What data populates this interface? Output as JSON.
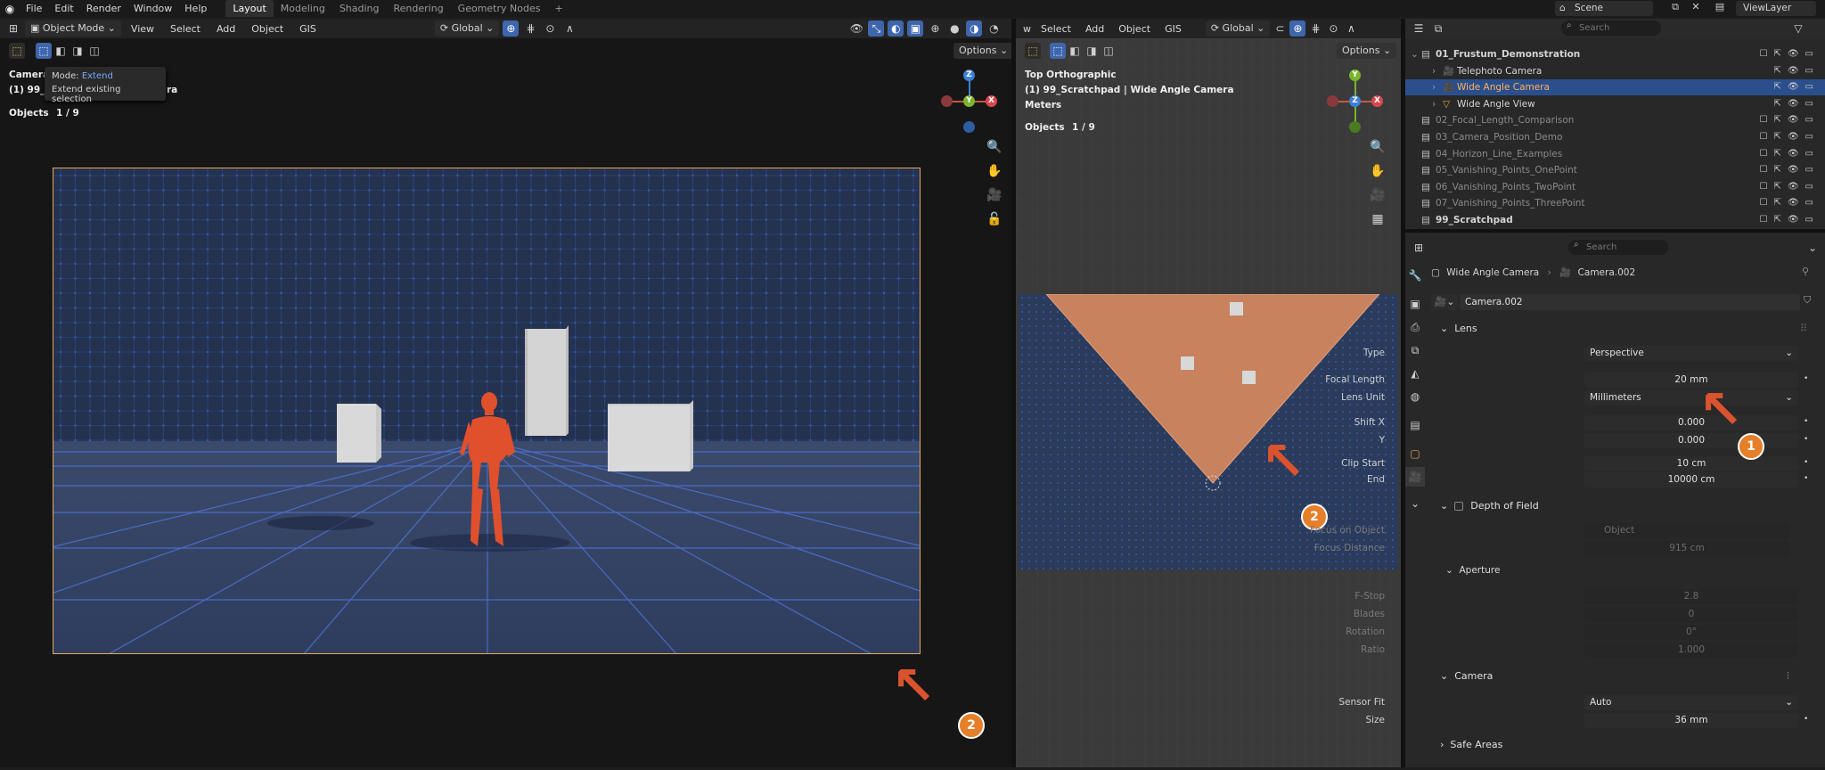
{
  "topbar": {
    "menus": [
      "File",
      "Edit",
      "Render",
      "Window",
      "Help"
    ],
    "workspaces": [
      "Layout",
      "Modeling",
      "Shading",
      "Rendering",
      "Geometry Nodes"
    ],
    "scene": "Scene",
    "view_layer": "ViewLayer"
  },
  "left_header": {
    "mode": "Object Mode",
    "menus": [
      "View",
      "Select",
      "Add",
      "Object",
      "GIS"
    ],
    "orientation": "Global",
    "options": "Options"
  },
  "left_overlay": {
    "camera_title": "Camera",
    "camera_sub": "(1) 99_",
    "camera_sub_tail": "ra",
    "objects_label": "Objects",
    "objects_count": "1 / 9",
    "tooltip_mode_label": "Mode:",
    "tooltip_mode_value": "Extend",
    "tooltip_desc": "Extend existing selection"
  },
  "right_header": {
    "menus": [
      "w",
      "Select",
      "Add",
      "Object",
      "GIS"
    ],
    "orientation": "Global",
    "options": "Options"
  },
  "right_overlay": {
    "view_name": "Top Orthographic",
    "collection": "(1) 99_Scratchpad | Wide Angle Camera",
    "units": "Meters",
    "objects_label": "Objects",
    "objects_count": "1 / 9"
  },
  "outliner": {
    "search_placeholder": "Search",
    "rows": [
      {
        "label": "01_Frustum_Demonstration",
        "indent": 1
      },
      {
        "label": "Telephoto Camera",
        "indent": 2
      },
      {
        "label": "Wide Angle Camera",
        "indent": 2
      },
      {
        "label": "Wide Angle View",
        "indent": 2
      },
      {
        "label": "02_Focal_Length_Comparison",
        "indent": 1
      },
      {
        "label": "03_Camera_Position_Demo",
        "indent": 1
      },
      {
        "label": "04_Horizon_Line_Examples",
        "indent": 1
      },
      {
        "label": "05_Vanishing_Points_OnePoint",
        "indent": 1
      },
      {
        "label": "06_Vanishing_Points_TwoPoint",
        "indent": 1
      },
      {
        "label": "07_Vanishing_Points_ThreePoint",
        "indent": 1
      },
      {
        "label": "99_Scratchpad",
        "indent": 1
      }
    ]
  },
  "properties": {
    "search_placeholder": "Search",
    "breadcrumb_object": "Wide Angle Camera",
    "breadcrumb_data": "Camera.002",
    "data_name": "Camera.002",
    "lens": {
      "title": "Lens",
      "type_label": "Type",
      "type_value": "Perspective",
      "focal_label": "Focal Length",
      "focal_value": "20 mm",
      "unit_label": "Lens Unit",
      "unit_value": "Millimeters",
      "shiftx_label": "Shift X",
      "shiftx_value": "0.000",
      "shifty_label": "Y",
      "shifty_value": "0.000",
      "clipstart_label": "Clip Start",
      "clipstart_value": "10 cm",
      "clipend_label": "End",
      "clipend_value": "10000 cm"
    },
    "dof": {
      "title": "Depth of Field",
      "focus_obj_label": "Focus on Object",
      "focus_obj_placeholder": "Object",
      "focus_dist_label": "Focus Distance",
      "focus_dist_value": "915 cm",
      "aperture_title": "Aperture",
      "fstop_label": "F-Stop",
      "fstop_value": "2.8",
      "blades_label": "Blades",
      "blades_value": "0",
      "rotation_label": "Rotation",
      "rotation_value": "0°",
      "ratio_label": "Ratio",
      "ratio_value": "1.000"
    },
    "camera": {
      "title": "Camera",
      "fit_label": "Sensor Fit",
      "fit_value": "Auto",
      "size_label": "Size",
      "size_value": "36 mm"
    },
    "safe_areas": {
      "title": "Safe Areas"
    }
  },
  "annotations": {
    "badge1": "1",
    "badge2": "2",
    "badge3": "2"
  },
  "colors": {
    "accent": "#3f66ad",
    "annotation": "#e57f2a",
    "arrow": "#d9532e",
    "frustum": "#c8825e"
  }
}
